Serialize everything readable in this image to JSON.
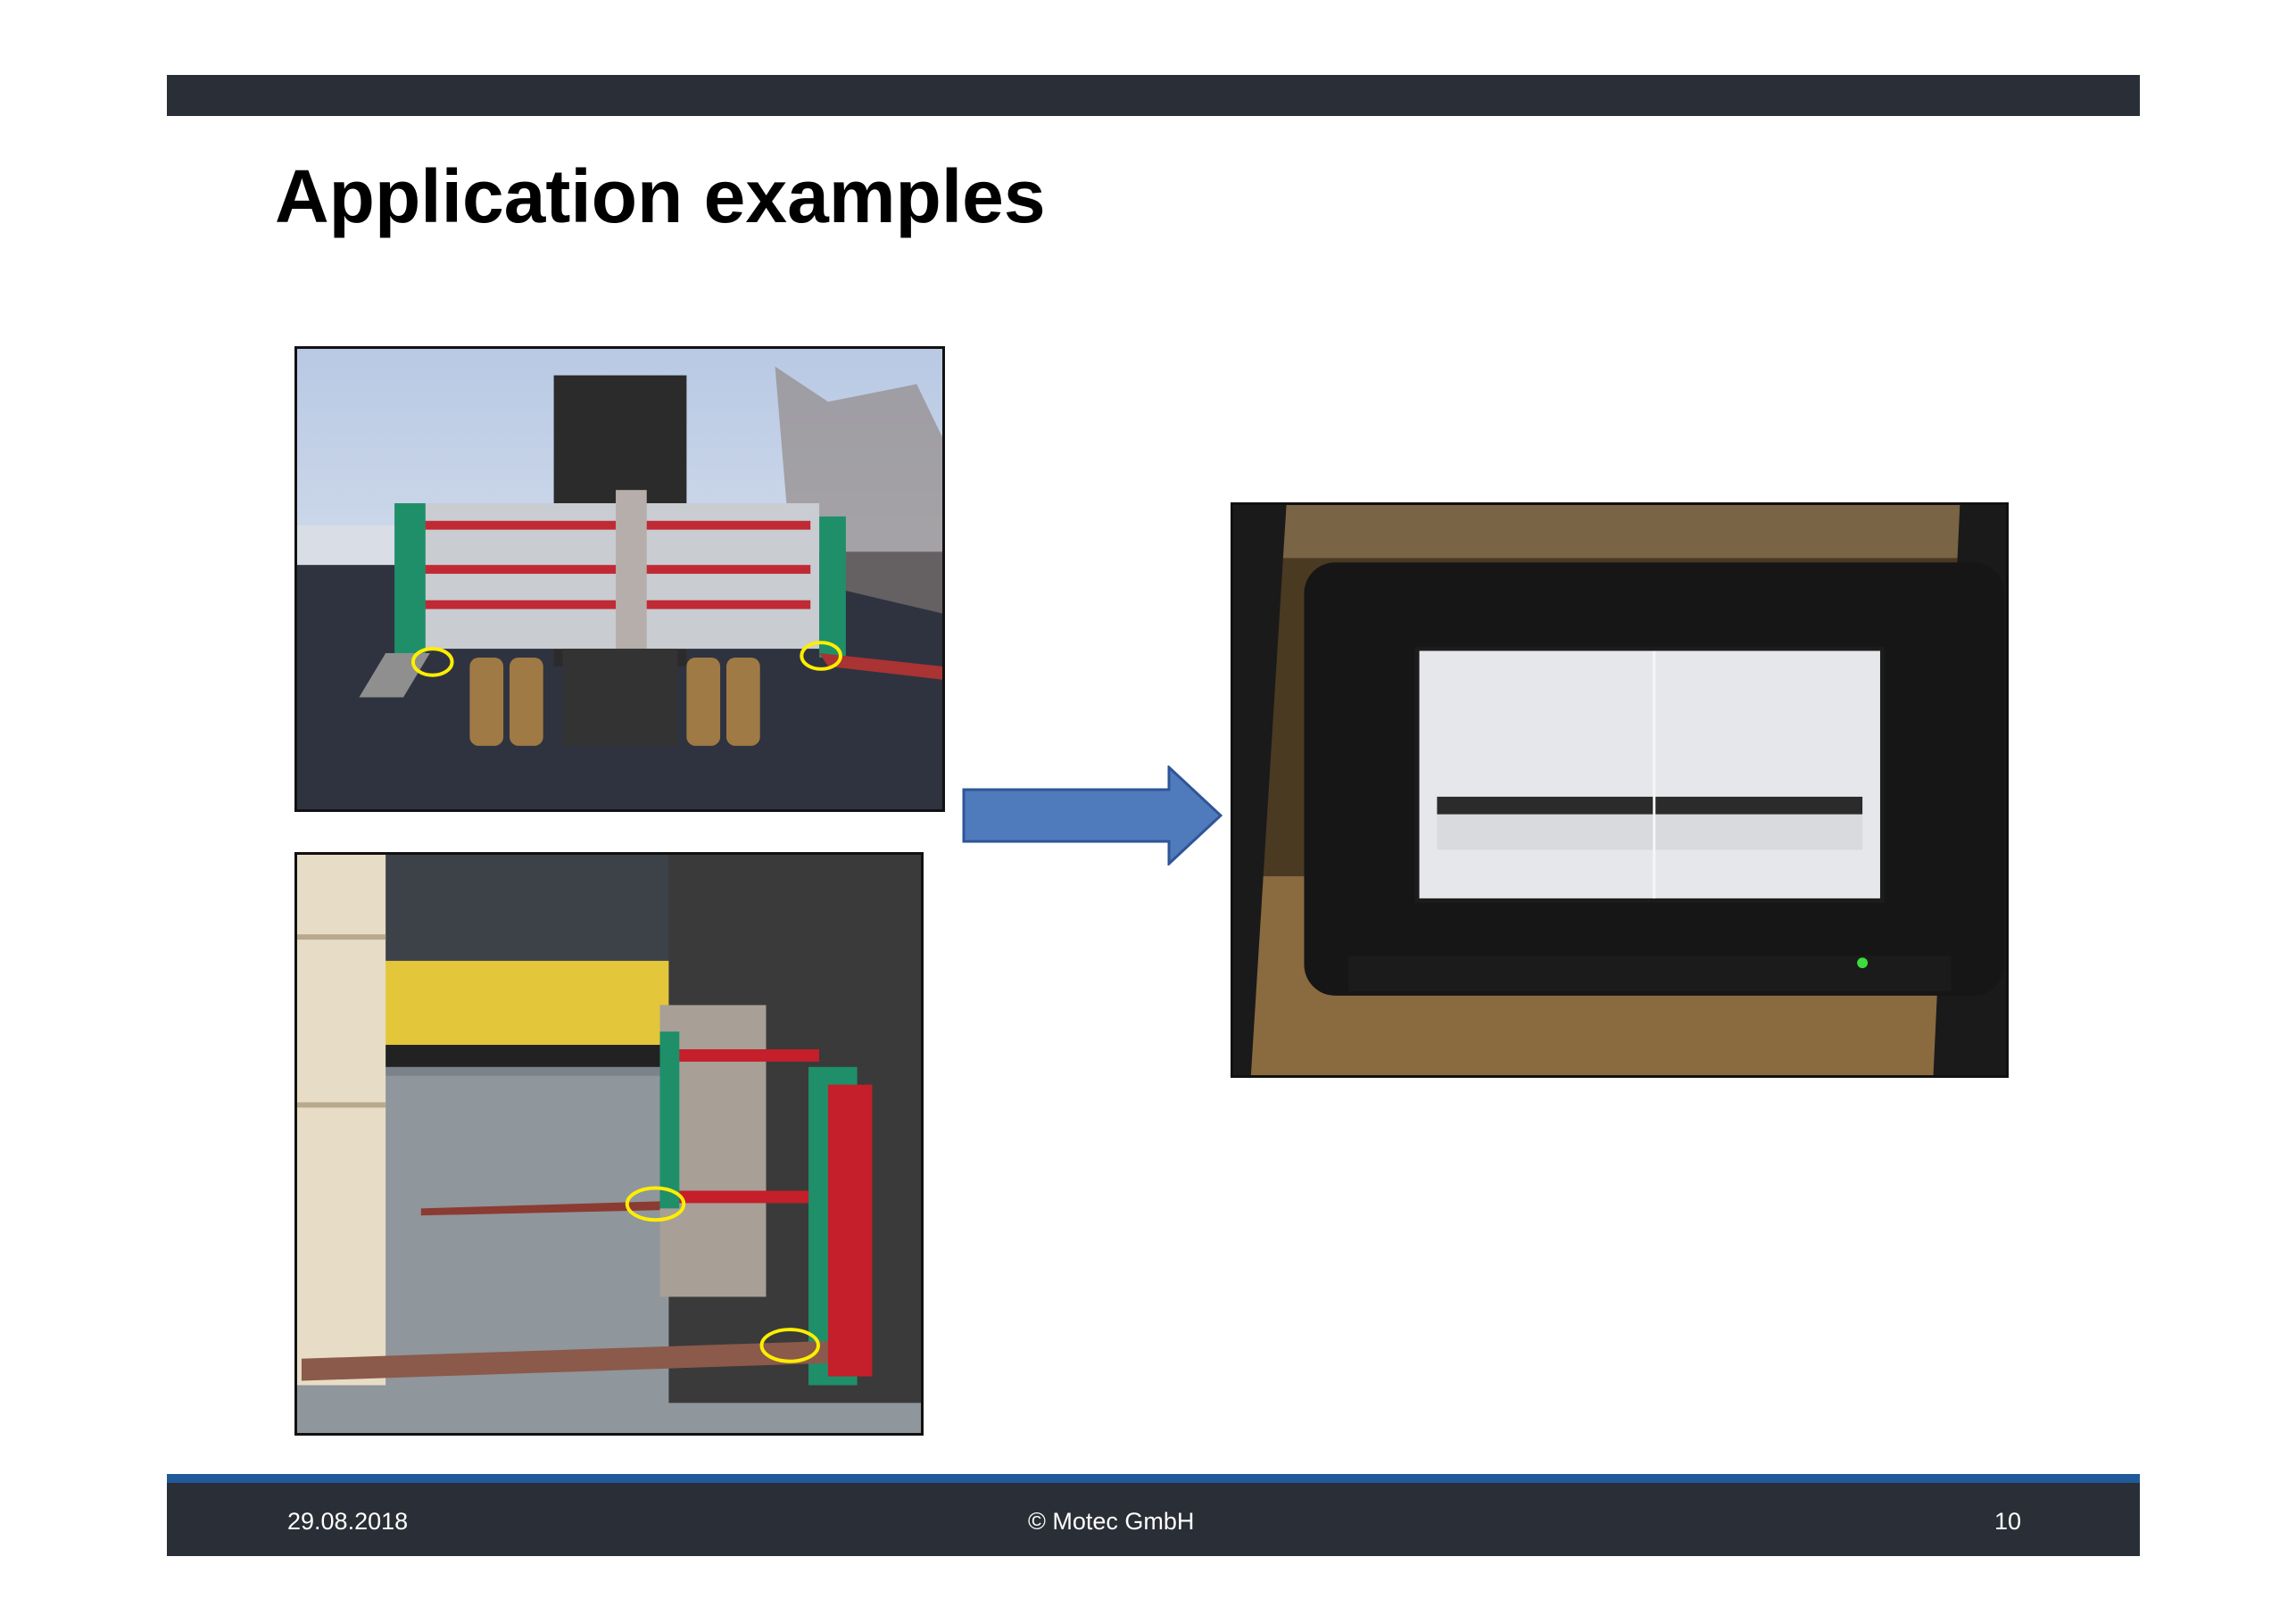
{
  "slide": {
    "title": "Application examples"
  },
  "images": {
    "top_left": {
      "icon": "forklift-clamp-outdoor-photo",
      "markers": 2
    },
    "bottom_left": {
      "icon": "forklift-clamp-warehouse-photo",
      "markers": 2
    },
    "right": {
      "icon": "monitor-camera-view-photo"
    }
  },
  "arrow": {
    "icon": "right-arrow-icon",
    "color": "#4f7bbd"
  },
  "footer": {
    "date": "29.08.2018",
    "copyright": "© Motec GmbH",
    "page_number": "10"
  },
  "colors": {
    "header_bar": "#2a2e36",
    "footer_bar": "#2a2e36",
    "footer_stripe": "#1f5b9b",
    "marker": "#ffee00"
  }
}
